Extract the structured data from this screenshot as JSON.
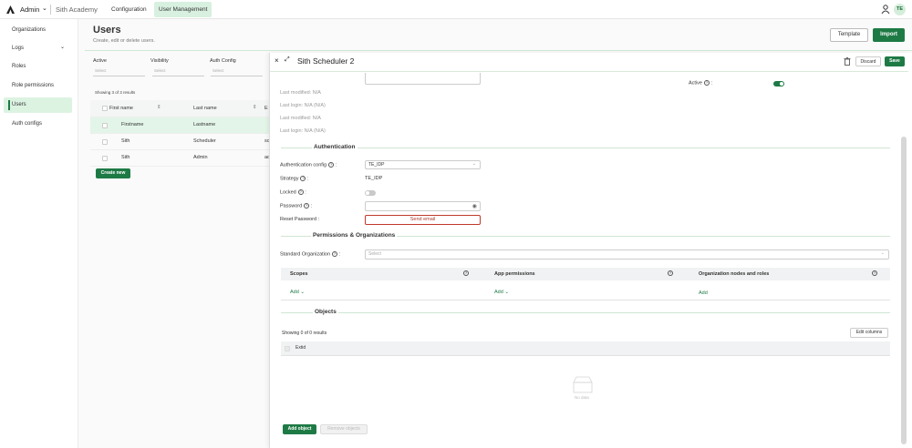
{
  "topbar": {
    "user": "Admin",
    "org": "Sith Academy",
    "tabs": [
      "Configuration",
      "User Management"
    ],
    "avatar": "TE"
  },
  "sidebar": {
    "items": [
      "Organizations",
      "Logs",
      "Roles",
      "Role permissions",
      "Users",
      "Auth configs"
    ]
  },
  "main": {
    "title": "Users",
    "subtitle": "Create, edit or delete users.",
    "template_label": "Template",
    "import_label": "Import",
    "filters": [
      {
        "label": "Active",
        "placeholder": "Select"
      },
      {
        "label": "Visibility",
        "placeholder": "Select"
      },
      {
        "label": "Auth Config",
        "placeholder": "Select"
      }
    ],
    "showing": "Showing 3 of 3 results",
    "columns": [
      "First name",
      "Last name",
      "E"
    ],
    "rows": [
      {
        "first": "Firstname",
        "last": "Lastname",
        "extra": ""
      },
      {
        "first": "Sith",
        "last": "Scheduler",
        "extra": "sc"
      },
      {
        "first": "Sith",
        "last": "Admin",
        "extra": "ad"
      }
    ],
    "create_label": "Create new"
  },
  "panel": {
    "title": "Sith Scheduler 2",
    "discard_label": "Discard",
    "save_label": "Save",
    "active_label": "Active",
    "meta": [
      "Last modified: N/A",
      "Last login: N/A (N/A)",
      "Last modified: N/A",
      "Last login: N/A (N/A)"
    ],
    "auth": {
      "section": "Authentication",
      "config_label": "Authentication config",
      "config_value": "TE_IDP",
      "strategy_label": "Strategy",
      "strategy_value": "TE_IDP",
      "locked_label": "Locked",
      "password_label": "Password",
      "reset_label": "Reset Password",
      "send_email": "Send email"
    },
    "perms": {
      "section": "Permissions & Organizations",
      "std_org_label": "Standard Organization",
      "std_org_placeholder": "Select",
      "cols": [
        "Scopes",
        "App permissions",
        "Organization nodes and roles"
      ],
      "add": "Add"
    },
    "objects": {
      "section": "Objects",
      "showing": "Showing 0 of 0 results",
      "edit_columns": "Edit columns",
      "col": "Extid",
      "empty": "No data",
      "add_object": "Add object",
      "remove_objects": "Remove objects"
    }
  },
  "colors": {
    "accent": "#1e7a45",
    "accent_light": "#d8f0df"
  }
}
